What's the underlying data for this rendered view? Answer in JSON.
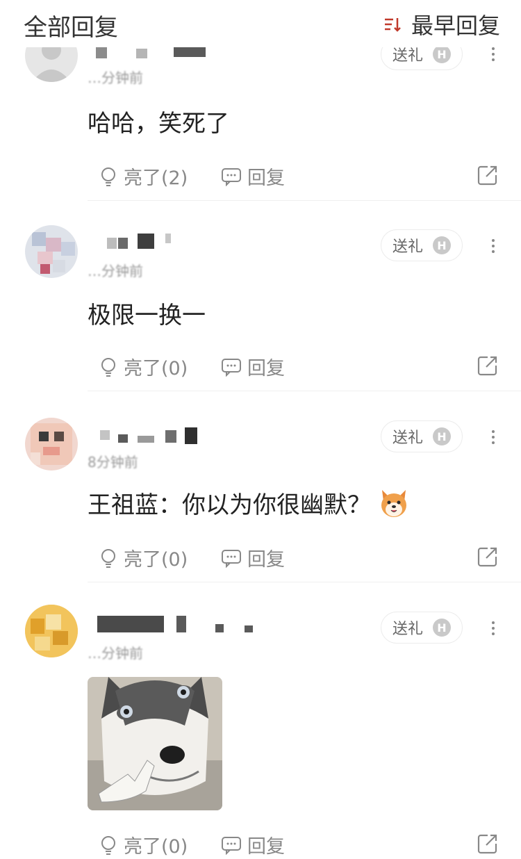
{
  "header": {
    "title": "全部回复",
    "sort_label": "最早回复",
    "sort_icon": "sort-icon"
  },
  "colors": {
    "sort_accent": "#c0392b",
    "action_gray": "#888888",
    "text_main": "#222222"
  },
  "comments": [
    {
      "time": "…分钟前",
      "gift_label": "送礼",
      "gift_badge": "H",
      "text": "哈哈，笑死了",
      "like_label": "亮了(2)",
      "reply_label": "回复"
    },
    {
      "time": "…分钟前",
      "gift_label": "送礼",
      "gift_badge": "H",
      "text": "极限一换一",
      "like_label": "亮了(0)",
      "reply_label": "回复"
    },
    {
      "time": "8分钟前",
      "gift_label": "送礼",
      "gift_badge": "H",
      "text": "王祖蓝：你以为你很幽默？",
      "emoji": "shiba-dog-emoji",
      "like_label": "亮了(0)",
      "reply_label": "回复"
    },
    {
      "time": "…分钟前",
      "gift_label": "送礼",
      "gift_badge": "H",
      "image": "husky-sticker",
      "like_label": "亮了(0)",
      "reply_label": "回复"
    }
  ]
}
